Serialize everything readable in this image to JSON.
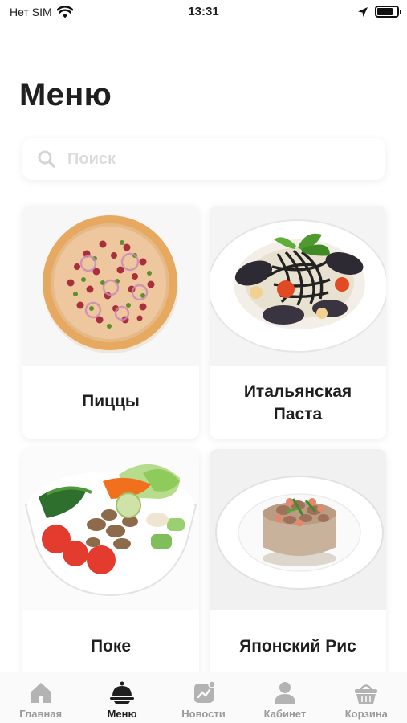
{
  "status_bar": {
    "carrier": "Нет SIM",
    "time": "13:31",
    "battery_level": 0.8
  },
  "page": {
    "title": "Меню"
  },
  "search": {
    "placeholder": "Поиск",
    "value": ""
  },
  "categories": [
    {
      "label": "Пиццы",
      "icon": "pizza-image"
    },
    {
      "label": "Итальянская Паста",
      "icon": "pasta-image"
    },
    {
      "label": "Поке",
      "icon": "poke-bowl-image"
    },
    {
      "label": "Японский Рис",
      "icon": "rice-plate-image"
    }
  ],
  "tab_bar": {
    "active": "Меню",
    "items": [
      {
        "label": "Главная",
        "icon": "home-icon"
      },
      {
        "label": "Меню",
        "icon": "cloche-icon"
      },
      {
        "label": "Новости",
        "icon": "news-icon"
      },
      {
        "label": "Кабинет",
        "icon": "profile-icon"
      },
      {
        "label": "Корзина",
        "icon": "basket-icon"
      }
    ]
  },
  "colors": {
    "background": "#ffffff",
    "text": "#1f1f1f",
    "inactive_tab": "#9a9a9a",
    "placeholder": "#dcdcdc"
  }
}
